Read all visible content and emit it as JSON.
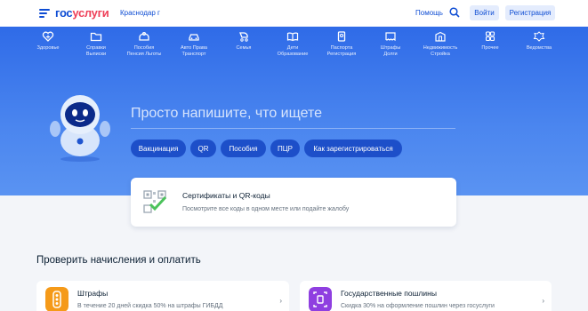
{
  "header": {
    "logo_part1": "гос",
    "logo_part2": "услуги",
    "region": "Краснодар г",
    "help": "Помощь",
    "login": "Войти",
    "register": "Регистрация"
  },
  "categories": [
    {
      "line1": "Здоровье",
      "line2": "",
      "icon": "heart-icon"
    },
    {
      "line1": "Справки",
      "line2": "Выписки",
      "icon": "folder-icon"
    },
    {
      "line1": "Пособия",
      "line2": "Пенсия Льготы",
      "icon": "benefits-icon"
    },
    {
      "line1": "Авто Права",
      "line2": "Транспорт",
      "icon": "car-icon"
    },
    {
      "line1": "Семья",
      "line2": "",
      "icon": "stroller-icon"
    },
    {
      "line1": "Дети",
      "line2": "Образование",
      "icon": "book-icon"
    },
    {
      "line1": "Паспорта",
      "line2": "Регистрация",
      "icon": "passport-icon"
    },
    {
      "line1": "Штрафы",
      "line2": "Долги",
      "icon": "ticket-icon"
    },
    {
      "line1": "Недвижимость",
      "line2": "Стройка",
      "icon": "building-icon"
    },
    {
      "line1": "Прочее",
      "line2": "",
      "icon": "grid-icon"
    },
    {
      "line1": "Ведомства",
      "line2": "",
      "icon": "emblem-icon"
    }
  ],
  "hero": {
    "query_placeholder": "Просто напишите, что ищете",
    "chips": [
      "Вакцинация",
      "QR",
      "Пособия",
      "ПЦР",
      "Как зарегистрироваться"
    ]
  },
  "qr_card": {
    "title": "Сертификаты и QR-коды",
    "subtitle": "Посмотрите все коды в одном месте или подайте жалобу"
  },
  "payments": {
    "title": "Проверить начисления и оплатить",
    "items": [
      {
        "title": "Штрафы",
        "subtitle": "В течение 20 дней скидка 50% на штрафы ГИБДД",
        "icon": "traffic-light-icon",
        "color": "#f59a19"
      },
      {
        "title": "Государственные пошлины",
        "subtitle": "Скидка 30% на оформление пошлин через госуслуги",
        "icon": "receipt-icon",
        "color": "#8f3fe0"
      }
    ]
  },
  "colors": {
    "brand": "#0d4cd3",
    "accent": "#ee3f58",
    "hero": "#3b79ec"
  }
}
